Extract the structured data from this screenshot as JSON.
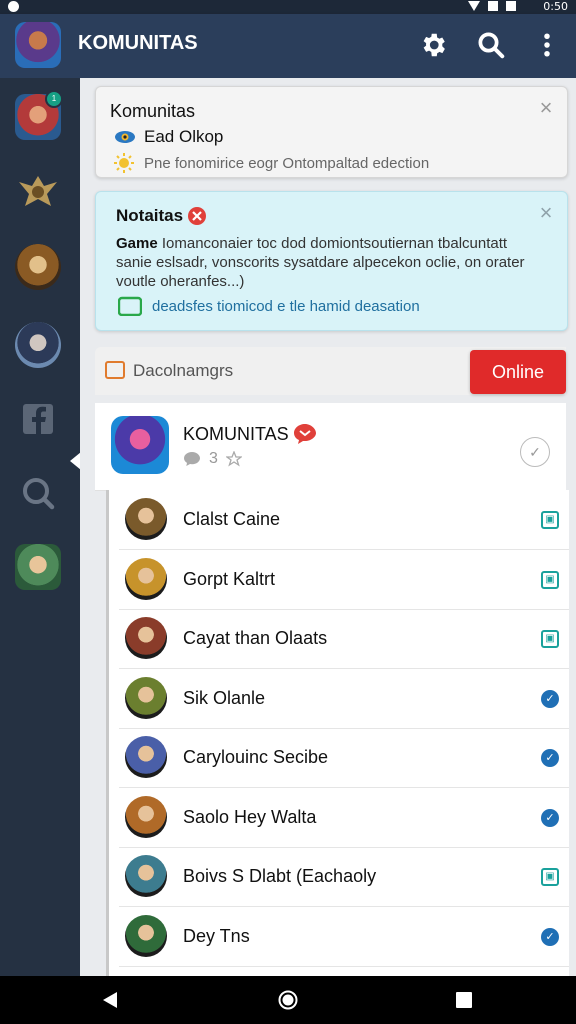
{
  "status_bar": {
    "time": "0:50"
  },
  "app_bar": {
    "title": "KOMUNITAS"
  },
  "sidebar": {
    "items": [
      {
        "name": "avatar-1",
        "badge": "1"
      },
      {
        "name": "emblem"
      },
      {
        "name": "avatar-2"
      },
      {
        "name": "avatar-3"
      },
      {
        "name": "facebook"
      },
      {
        "name": "search"
      },
      {
        "name": "avatar-4"
      }
    ]
  },
  "card1": {
    "title": "Komunitas",
    "line2": "Ead Olkop",
    "line3": "Pne fonomirice eogr Ontompaltad edection"
  },
  "card2": {
    "title": "Notaitas",
    "body_bold": "Game",
    "body": " Iomanconaier toc dod domiontsoutiernan tbalcuntatt sanie eslsadr, vonscorits sysatdare alpecekon oclie, on orater voutle oheranfes...)",
    "link": "deadsfes tiomicod e tle hamid deasation"
  },
  "category": {
    "label": "Dacolnamgrs",
    "online_button": "Online"
  },
  "group": {
    "name": "KOMUNITAS",
    "count": "3"
  },
  "members": [
    {
      "name": "Clalst Caine",
      "badge": "square",
      "color": "#7a5a2b"
    },
    {
      "name": "Gorpt Kaltrt",
      "badge": "square",
      "color": "#c7932b"
    },
    {
      "name": "Cayat than Olaats",
      "badge": "square",
      "color": "#8a3c2a"
    },
    {
      "name": "Sik Olanle",
      "badge": "round",
      "color": "#6b7f2f"
    },
    {
      "name": "Carylouinc Secibe",
      "badge": "round",
      "color": "#4a5fa8"
    },
    {
      "name": "Saolo Hey Walta",
      "badge": "round",
      "color": "#b06a28"
    },
    {
      "name": "Boivs S Dlabt (Eachaoly",
      "badge": "square",
      "color": "#3d7c8f"
    },
    {
      "name": "Dey Tns",
      "badge": "round",
      "color": "#2f6b3a"
    }
  ],
  "colors": {
    "accent": "#2b3e5b",
    "online": "#e02a2a",
    "sidebar": "#253142"
  }
}
